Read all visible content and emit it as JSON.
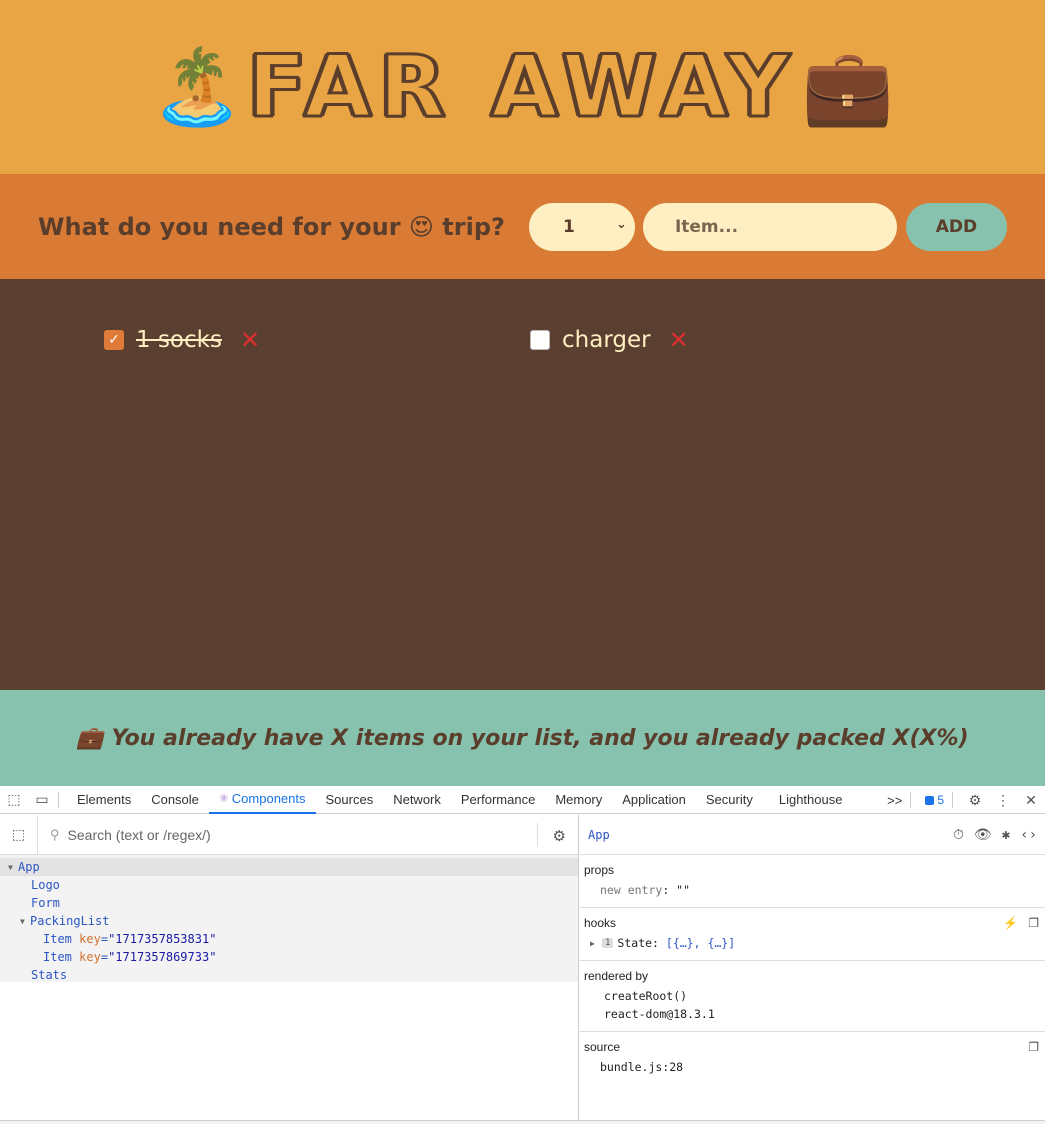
{
  "header": {
    "left_emoji": "🏝️",
    "title": "FAR AWAY",
    "right_emoji": "💼"
  },
  "form": {
    "question": "What do you need for your 😍 trip?",
    "quantity_value": "1",
    "item_placeholder": "Item...",
    "add_label": "ADD"
  },
  "list": {
    "items": [
      {
        "label": "1 socks",
        "packed": true,
        "delete_icon": "✕"
      },
      {
        "label": "charger",
        "packed": false,
        "delete_icon": "✕"
      }
    ]
  },
  "stats": {
    "text": "💼 You already have X items on your list, and you already packed X(X%)"
  },
  "devtools": {
    "tabs": [
      "Elements",
      "Console",
      "Components",
      "Sources",
      "Network",
      "Performance",
      "Memory",
      "Application",
      "Security",
      "Lighthouse"
    ],
    "active_tab": "Components",
    "more": ">>",
    "issues_count": "5",
    "search_placeholder": "Search (text or /regex/)",
    "tree": {
      "app": "App",
      "logo": "Logo",
      "form": "Form",
      "packing_list": "PackingList",
      "item": "Item",
      "key_attr": "key",
      "item1_key": "\"1717357853831\"",
      "item2_key": "\"1717357869733\"",
      "stats": "Stats"
    },
    "selected_component": "App",
    "props": {
      "title": "props",
      "entry_key": "new entry",
      "entry_value": "\"\""
    },
    "hooks": {
      "title": "hooks",
      "index": "1",
      "state_label": "State:",
      "state_value": "[{…}, {…}]"
    },
    "rendered_by": {
      "title": "rendered by",
      "lines": [
        "createRoot()",
        "react-dom@18.3.1"
      ]
    },
    "source": {
      "title": "source",
      "value": "bundle.js:28"
    },
    "colors": {
      "accent": "#1a73e8",
      "header_bg": "#e9a543",
      "form_bg": "#d97a35",
      "list_bg": "#5a3f30",
      "stats_bg": "#86c2ae"
    }
  }
}
